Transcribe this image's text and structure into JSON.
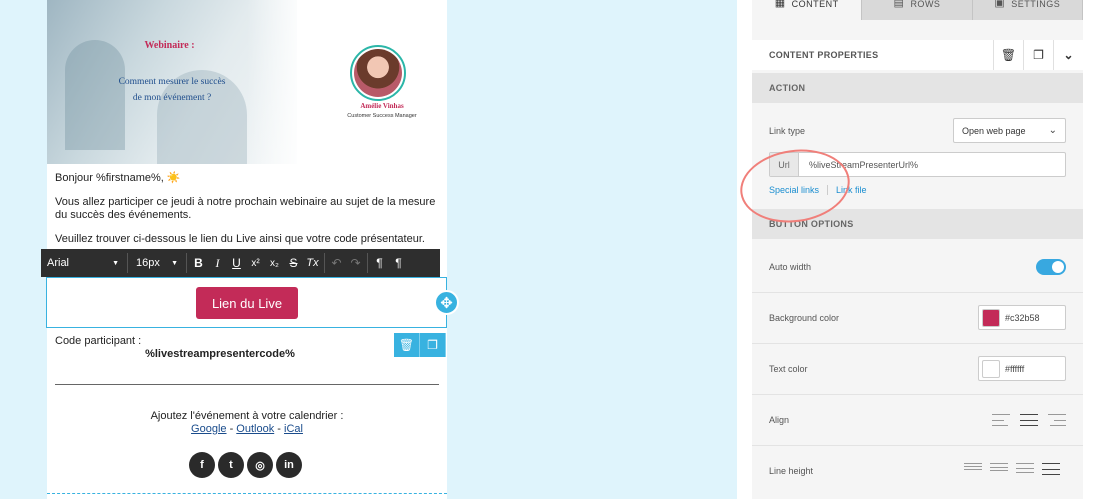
{
  "email": {
    "hero": {
      "title": "Webinaire :",
      "subtitle_line1": "Comment mesurer le succès",
      "subtitle_line2": "de mon événement ?",
      "presenter_name": "Amélie Vinhas",
      "presenter_role": "Customer Success Manager"
    },
    "greeting": "Bonjour %firstname%, ☀️",
    "paragraph1": "Vous allez participer ce jeudi à notre prochain webinaire au sujet de la mesure du succès des événements.",
    "paragraph2": "Veuillez trouver ci-dessous le lien du Live ainsi que votre code présentateur.",
    "button_label": "Lien du Live",
    "code_label": "Code participant :",
    "code_value": "%livestreampresentercode%",
    "calendar_text": "Ajoutez l'événement à votre calendrier :",
    "calendar_links": {
      "google": "Google",
      "sep1": " - ",
      "outlook": "Outlook",
      "sep2": "  - ",
      "ical": "iCal"
    },
    "social": {
      "facebook": "f",
      "twitter": "t",
      "instagram": "◎",
      "linkedin": "in"
    }
  },
  "toolbar": {
    "font": "Arial",
    "size": "16px",
    "bold": "B",
    "italic": "I",
    "underline": "U",
    "superscript": "x²",
    "subscript": "x₂",
    "strike": "S",
    "clear": "Tx",
    "undo": "↶",
    "redo": "↷",
    "ltr": "¶",
    "rtl": "¶"
  },
  "panel": {
    "tabs": [
      {
        "label": "CONTENT"
      },
      {
        "label": "ROWS"
      },
      {
        "label": "SETTINGS"
      }
    ],
    "content_properties": "CONTENT PROPERTIES",
    "action_header": "ACTION",
    "link_type_label": "Link type",
    "link_type_value": "Open web page",
    "url_prefix": "Url",
    "url_value": "%liveStreamPresenterUrl%",
    "special_links": "Special links",
    "link_file": "Link file",
    "button_options_header": "BUTTON OPTIONS",
    "auto_width_label": "Auto width",
    "auto_width_on": true,
    "bg_color_label": "Background color",
    "bg_color_value": "#c32b58",
    "text_color_label": "Text color",
    "text_color_value": "#ffffff",
    "align_label": "Align",
    "line_height_label": "Line height"
  },
  "colors": {
    "accent": "#c32b58",
    "highlight": "#38b2e0",
    "link": "#1b8ed0"
  }
}
